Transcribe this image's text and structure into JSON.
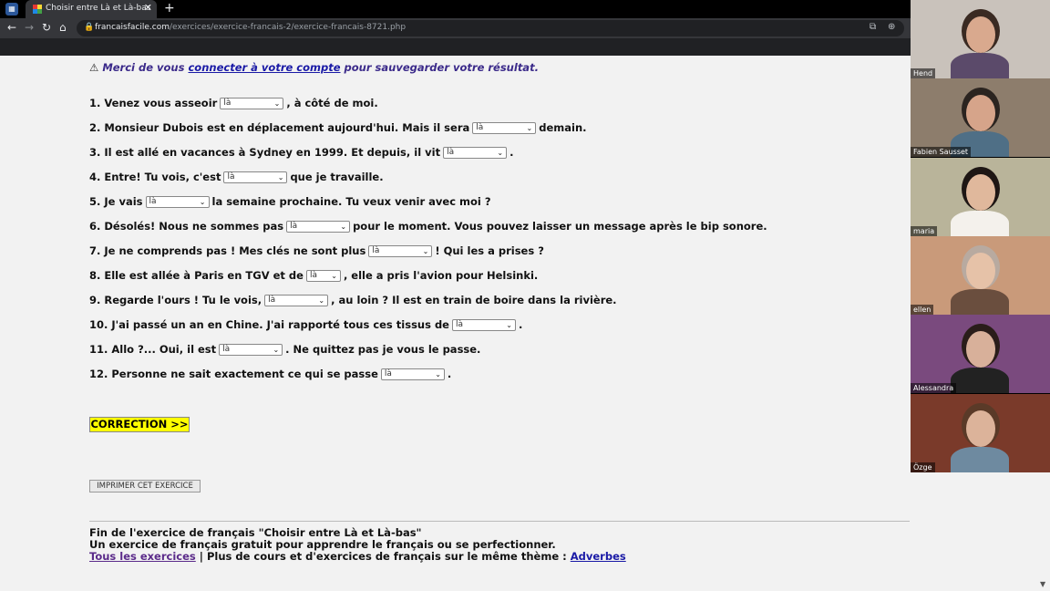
{
  "browser": {
    "tab_title": "Choisir entre Là et Là-bas",
    "url_domain": "francaisfacile.com",
    "url_path": "/exercices/exercice-francais-2/exercice-francais-8721.php"
  },
  "notice": {
    "prefix": "Merci de vous",
    "link": "connecter à votre compte",
    "suffix": "pour sauvegarder votre résultat."
  },
  "questions": [
    {
      "before": "1. Venez vous asseoir",
      "value": "là",
      "after": ", à côté de moi."
    },
    {
      "before": "2. Monsieur Dubois est en déplacement aujourd'hui. Mais il sera",
      "value": "là",
      "after": "demain."
    },
    {
      "before": "3. Il est allé en vacances à Sydney en 1999. Et depuis, il vit",
      "value": "là",
      "after": "."
    },
    {
      "before": "4. Entre! Tu vois, c'est",
      "value": "là",
      "after": "que je travaille."
    },
    {
      "before": "5. Je vais",
      "value": "là",
      "after": "la semaine prochaine. Tu veux venir avec moi ?"
    },
    {
      "before": "6. Désolés! Nous ne sommes pas",
      "value": "là",
      "after": "pour le moment. Vous pouvez laisser un message après le bip sonore."
    },
    {
      "before": "7. Je ne comprends pas ! Mes clés ne sont plus",
      "value": "là",
      "after": "! Qui les a prises ?"
    },
    {
      "before": "8. Elle est allée à Paris en TGV et de",
      "value": "là",
      "after": ", elle a pris l'avion pour Helsinki."
    },
    {
      "before": "9. Regarde l'ours ! Tu le vois,",
      "value": "là",
      "after": ", au loin ? Il est en train de boire dans la rivière."
    },
    {
      "before": "10. J'ai passé un an en Chine. J'ai rapporté tous ces tissus de",
      "value": "là",
      "after": "."
    },
    {
      "before": "11. Allo ?... Oui, il est",
      "value": "là",
      "after": ". Ne quittez pas je vous le passe."
    },
    {
      "before": "12. Personne ne sait exactement ce qui se passe",
      "value": "là",
      "after": "."
    }
  ],
  "buttons": {
    "correction": "CORRECTION >>",
    "print": "IMPRIMER CET EXERCICE"
  },
  "footer": {
    "line1": "Fin de l'exercice de français \"Choisir entre Là et Là-bas\"",
    "line2": "Un exercice de français gratuit pour apprendre le français ou se perfectionner.",
    "all_link": "Tous les exercices",
    "middle": "| Plus de cours et d'exercices de français sur le même thème :",
    "theme_link": "Adverbes"
  },
  "participants": [
    {
      "name": "Hend",
      "bg": "#c9c2bb",
      "skin": "#d9a98e",
      "hair": "#3a2a22",
      "shirt": "#5b4a6a"
    },
    {
      "name": "Fabien Sausset",
      "bg": "#8d7d6c",
      "skin": "#d6a48a",
      "hair": "#2b2420",
      "shirt": "#4f6f86"
    },
    {
      "name": "maria",
      "bg": "#b9b49a",
      "skin": "#e0b89c",
      "hair": "#1e1614",
      "shirt": "#f4f1ec"
    },
    {
      "name": "ellen",
      "bg": "#c99a7a",
      "skin": "#e6c2a8",
      "hair": "#b8aaa0",
      "shirt": "#6a4e3e"
    },
    {
      "name": "Alessandra",
      "bg": "#7a4a7e",
      "skin": "#d8b09a",
      "hair": "#2a1d1a",
      "shirt": "#222222"
    },
    {
      "name": "Özge",
      "bg": "#7a3a2a",
      "skin": "#dcb39a",
      "hair": "#5a3a28",
      "shirt": "#6e8aa0"
    }
  ]
}
